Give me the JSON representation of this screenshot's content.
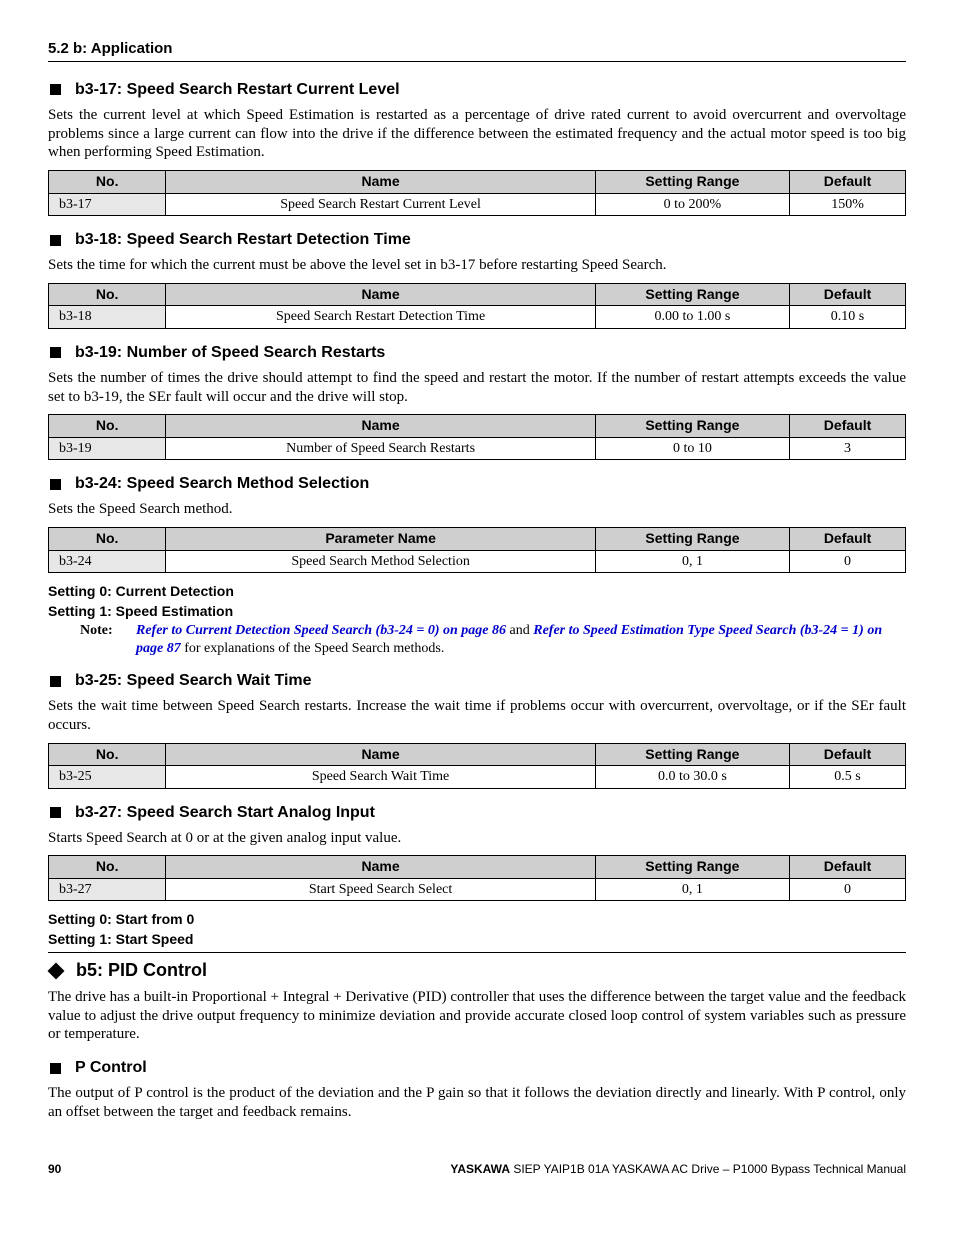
{
  "page_header": "5.2 b: Application",
  "headers_std": {
    "no": "No.",
    "name": "Name",
    "range": "Setting Range",
    "def": "Default"
  },
  "headers_pname": {
    "no": "No.",
    "name": "Parameter Name",
    "range": "Setting Range",
    "def": "Default"
  },
  "b317": {
    "title": "b3-17: Speed Search Restart Current Level",
    "desc": "Sets the current level at which Speed Estimation is restarted as a percentage of drive rated current to avoid overcurrent and overvoltage problems since a large current can flow into the drive if the difference between the estimated frequency and the actual motor speed is too big when performing Speed Estimation.",
    "no": "b3-17",
    "name": "Speed Search Restart Current Level",
    "range": "0 to 200%",
    "def": "150%"
  },
  "b318": {
    "title": "b3-18: Speed Search Restart Detection Time",
    "desc": "Sets the time for which the current must be above the level set in b3-17 before restarting Speed Search.",
    "no": "b3-18",
    "name": "Speed Search Restart Detection Time",
    "range": "0.00 to 1.00 s",
    "def": "0.10 s"
  },
  "b319": {
    "title": "b3-19: Number of Speed Search Restarts",
    "desc": "Sets the number of times the drive should attempt to find the speed and restart the motor. If the number of restart attempts exceeds the value set to b3-19, the SEr fault will occur and the drive will stop.",
    "no": "b3-19",
    "name": "Number of Speed Search Restarts",
    "range": "0 to 10",
    "def": "3"
  },
  "b324": {
    "title": "b3-24: Speed Search Method Selection",
    "desc": "Sets the Speed Search method.",
    "no": "b3-24",
    "name": "Speed Search Method Selection",
    "range": "0, 1",
    "def": "0",
    "setting0": "Setting 0: Current Detection",
    "setting1": "Setting 1: Speed Estimation",
    "note_label": "Note:",
    "note_link1": "Refer to Current Detection Speed Search (b3-24 = 0) on page 86",
    "note_mid": " and ",
    "note_link2": "Refer to Speed Estimation Type Speed Search (b3-24 = 1) on page 87",
    "note_tail": " for explanations of the Speed Search methods."
  },
  "b325": {
    "title": "b3-25: Speed Search Wait Time",
    "desc": "Sets the wait time between Speed Search restarts. Increase the wait time if problems occur with overcurrent, overvoltage, or if the SEr fault occurs.",
    "no": "b3-25",
    "name": "Speed Search Wait Time",
    "range": "0.0 to 30.0 s",
    "def": "0.5 s"
  },
  "b327": {
    "title": "b3-27: Speed Search Start Analog Input",
    "desc": "Starts Speed Search at 0 or at the given analog input value.",
    "no": "b3-27",
    "name": "Start Speed Search Select",
    "range": "0, 1",
    "def": "0",
    "setting0": "Setting 0: Start from 0",
    "setting1": "Setting 1: Start Speed"
  },
  "b5": {
    "title": "b5: PID Control",
    "desc": "The drive has a built-in Proportional + Integral + Derivative (PID) controller that uses the difference between the target value and the feedback value to adjust the drive output frequency to minimize deviation and provide accurate closed loop control of system variables such as pressure or temperature."
  },
  "pcontrol": {
    "title": "P Control",
    "desc": "The output of P control is the product of the deviation and the P gain so that it follows the deviation directly and linearly. With P control, only an offset between the target and feedback remains."
  },
  "footer": {
    "page": "90",
    "brand": "YASKAWA",
    "doc": " SIEP YAIP1B 01A YASKAWA AC Drive – P1000 Bypass Technical Manual"
  }
}
